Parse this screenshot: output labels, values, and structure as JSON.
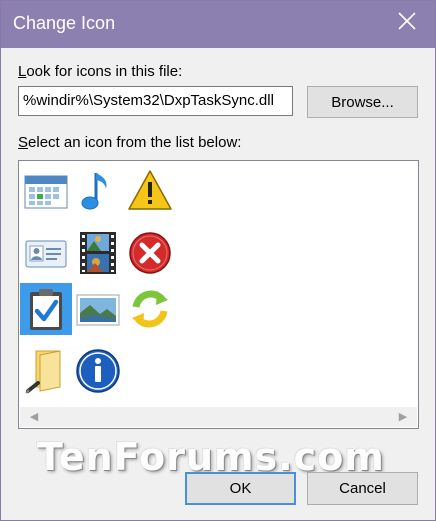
{
  "dialog": {
    "title": "Change Icon",
    "look_label_accel": "L",
    "look_label_rest": "ook for icons in this file:",
    "path_value": "%windir%\\System32\\DxpTaskSync.dll",
    "browse_label": "Browse...",
    "select_label_accel": "S",
    "select_label_rest": "elect an icon from the list below:",
    "ok_label": "OK",
    "cancel_label": "Cancel"
  },
  "icons": [
    {
      "name": "calendar-icon",
      "selected": false
    },
    {
      "name": "music-note-icon",
      "selected": false
    },
    {
      "name": "warning-icon",
      "selected": false
    },
    {
      "name": "contact-card-icon",
      "selected": false
    },
    {
      "name": "video-film-icon",
      "selected": false
    },
    {
      "name": "error-x-icon",
      "selected": false
    },
    {
      "name": "clipboard-check-icon",
      "selected": true
    },
    {
      "name": "landscape-picture-icon",
      "selected": false
    },
    {
      "name": "sync-arrows-icon",
      "selected": false
    },
    {
      "name": "folder-pen-icon",
      "selected": false
    },
    {
      "name": "info-icon",
      "selected": false
    }
  ],
  "watermark": "TenForums.com",
  "colors": {
    "titlebar": "#8c80b0",
    "selection": "#3d9be9",
    "default_button_border": "#4a90d9"
  }
}
